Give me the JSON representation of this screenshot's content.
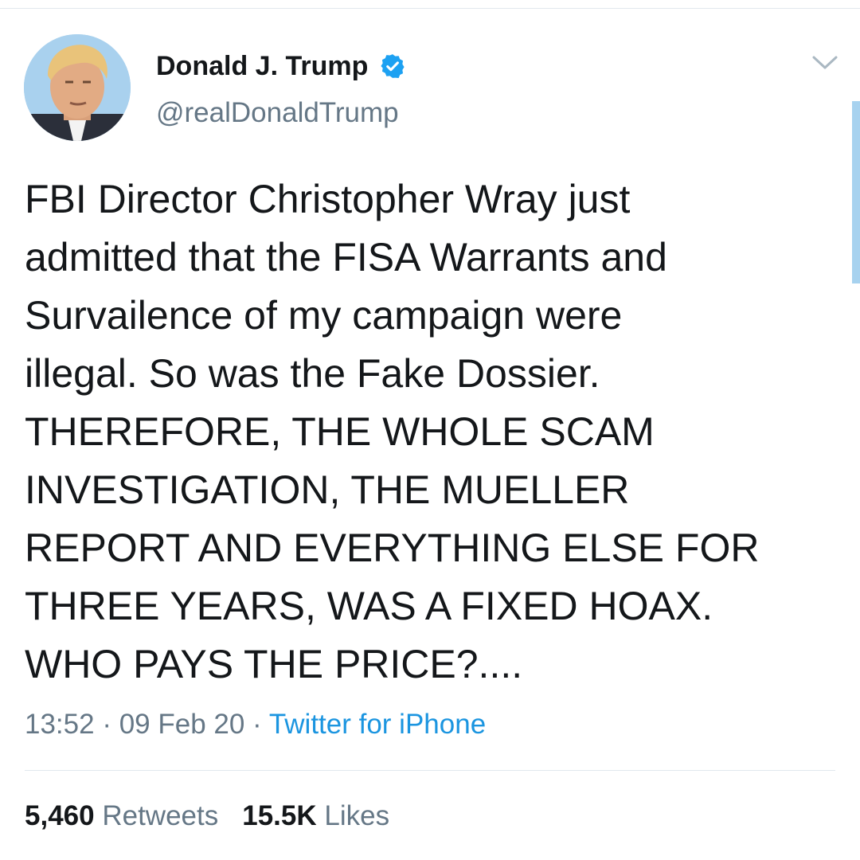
{
  "author": {
    "display_name": "Donald J. Trump",
    "handle": "@realDonaldTrump",
    "verified": true,
    "avatar_icon": "profile-photo"
  },
  "tweet": {
    "lines": [
      "FBI Director Christopher Wray just",
      "admitted that the FISA Warrants and",
      "Survailence of my campaign were",
      "illegal. So was the Fake Dossier.",
      "THEREFORE, THE WHOLE SCAM",
      "INVESTIGATION, THE MUELLER",
      "REPORT AND EVERYTHING ELSE FOR",
      "THREE YEARS, WAS A FIXED HOAX.",
      "WHO PAYS THE PRICE?...."
    ]
  },
  "meta": {
    "time": "13:52",
    "separator": " · ",
    "date": "09 Feb 20",
    "source": "Twitter for iPhone"
  },
  "stats": {
    "retweets_count": "5,460",
    "retweets_label": "Retweets",
    "likes_count": "15.5K",
    "likes_label": "Likes"
  },
  "colors": {
    "accent": "#1b95e0",
    "secondary_text": "#657786",
    "primary_text": "#14171a",
    "divider": "#e1e8ed"
  }
}
